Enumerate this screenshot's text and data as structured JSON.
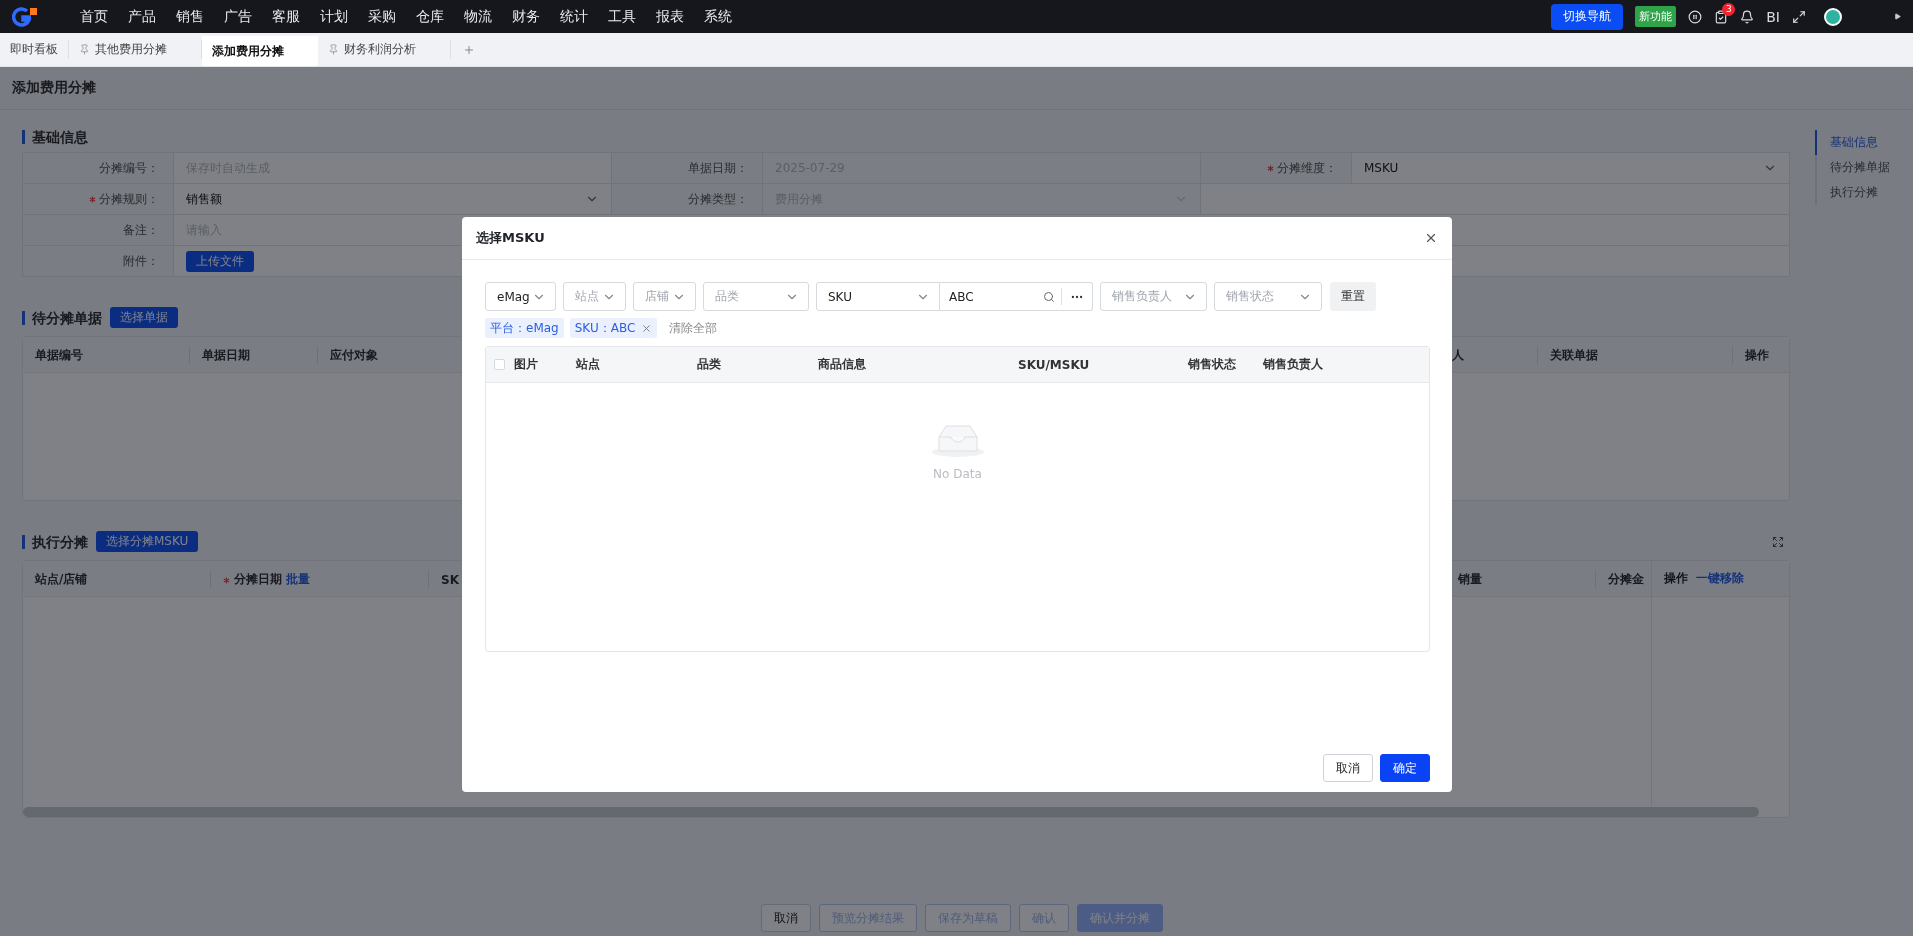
{
  "nav": {
    "items": [
      "首页",
      "产品",
      "销售",
      "广告",
      "客服",
      "计划",
      "采购",
      "仓库",
      "物流",
      "财务",
      "统计",
      "工具",
      "报表",
      "系统"
    ],
    "switch_button": "切换导航",
    "new_badge": "新功能",
    "task_count": "3",
    "bi": "BI"
  },
  "tabs": [
    {
      "label": "即时看板",
      "pinned": false,
      "selected": false
    },
    {
      "label": "其他费用分摊",
      "pinned": true,
      "selected": false
    },
    {
      "label": "添加费用分摊",
      "pinned": false,
      "selected": true
    },
    {
      "label": "财务利润分析",
      "pinned": true,
      "selected": false
    }
  ],
  "page_title": "添加费用分摊",
  "anchors": [
    {
      "label": "基础信息",
      "selected": true
    },
    {
      "label": "待分摊单据",
      "selected": false
    },
    {
      "label": "执行分摊",
      "selected": false
    }
  ],
  "basic_info": {
    "title": "基础信息",
    "fields": [
      {
        "label": "分摊编号：",
        "kind": "text",
        "placeholder": "保存时自动生成",
        "required": false
      },
      {
        "label": "单据日期：",
        "kind": "text",
        "value": "2025-07-29",
        "required": false,
        "disabled": true
      },
      {
        "label": "分摊维度：",
        "kind": "select",
        "value": "MSKU",
        "required": true,
        "disabled": false
      },
      {
        "label": "分摊规则：",
        "kind": "select",
        "value": "销售额",
        "required": true,
        "disabled": false
      },
      {
        "label": "分摊类型：",
        "kind": "select",
        "value": "费用分摊",
        "required": false,
        "disabled": true
      },
      {
        "kind": "blank"
      },
      {
        "label": "备注：",
        "kind": "note",
        "placeholder": "请输入",
        "required": false
      },
      {
        "label": "附件：",
        "kind": "upload",
        "button": "上传文件",
        "required": false
      }
    ]
  },
  "pending_docs": {
    "title": "待分摊单据",
    "button": "选择单据",
    "columns": [
      "单据编号",
      "单据日期",
      "应付对象",
      "人",
      "关联单据",
      "操作"
    ]
  },
  "allocation": {
    "title": "执行分摊",
    "button": "选择分摊MSKU",
    "columns": [
      {
        "label": "站点/店铺",
        "required": false
      },
      {
        "label": "分摊日期",
        "required": true,
        "action": "批量"
      },
      {
        "label": "SK",
        "required": false
      },
      {
        "label": "销量",
        "required": false
      },
      {
        "label": "分摊金",
        "required": false
      }
    ],
    "fixed_column": {
      "label": "操作",
      "action": "一键移除"
    }
  },
  "footer_buttons": [
    {
      "label": "取消",
      "kind": "default",
      "disabled": false
    },
    {
      "label": "预览分摊结果",
      "kind": "default",
      "disabled": true
    },
    {
      "label": "保存为草稿",
      "kind": "default",
      "disabled": true
    },
    {
      "label": "确认",
      "kind": "default",
      "disabled": true
    },
    {
      "label": "确认并分摊",
      "kind": "primary",
      "disabled": true
    }
  ],
  "modal": {
    "title": "选择MSKU",
    "filters": [
      {
        "kind": "select",
        "value": "eMag"
      },
      {
        "kind": "select",
        "placeholder": "站点"
      },
      {
        "kind": "select",
        "placeholder": "店铺"
      },
      {
        "kind": "select",
        "placeholder": "品类"
      },
      {
        "kind": "search",
        "field": "SKU",
        "value": "ABC"
      },
      {
        "kind": "select",
        "placeholder": "销售负责人"
      },
      {
        "kind": "select",
        "placeholder": "销售状态"
      }
    ],
    "reset": "重置",
    "tags": [
      {
        "label": "平台：eMag",
        "removable": false
      },
      {
        "label": "SKU：ABC",
        "removable": true
      }
    ],
    "clear_all": "清除全部",
    "select_all": false,
    "columns": [
      "图片",
      "站点",
      "品类",
      "商品信息",
      "SKU/MSKU",
      "销售状态",
      "销售负责人"
    ],
    "empty_text": "No Data",
    "buttons": [
      {
        "label": "取消",
        "kind": "default"
      },
      {
        "label": "确定",
        "kind": "primary"
      }
    ]
  }
}
